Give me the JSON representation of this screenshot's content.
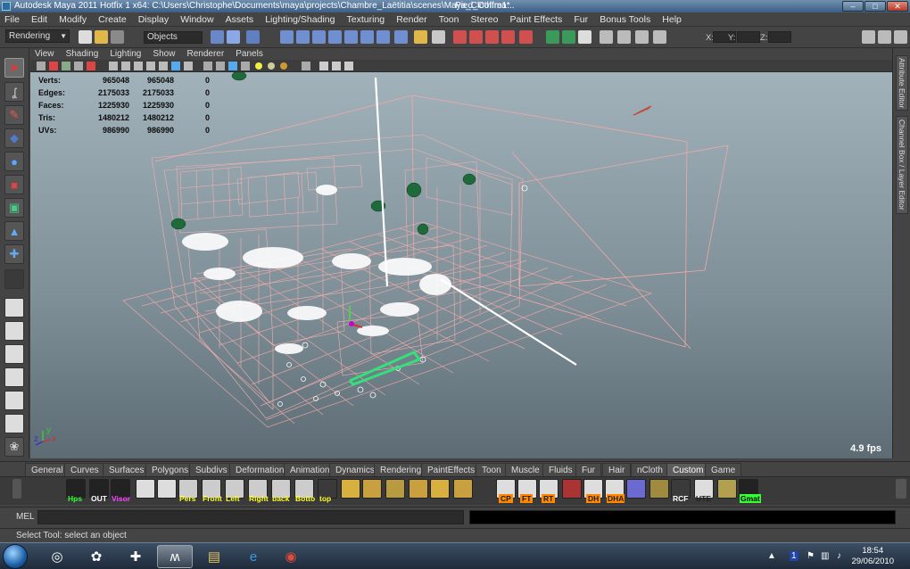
{
  "window": {
    "title": "Autodesk Maya 2011 Hotfix 1 x64: C:\\Users\\Christophe\\Documents\\maya\\projects\\Chambre_Laëtitia\\scenes\\Maya_Cloth.ma*",
    "second_title": "Pied_Coffre1...",
    "minimize": "–",
    "maximize": "□",
    "close": "✕"
  },
  "menubar": [
    "File",
    "Edit",
    "Modify",
    "Create",
    "Display",
    "Window",
    "Assets",
    "Lighting/Shading",
    "Texturing",
    "Render",
    "Toon",
    "Stereo",
    "Paint Effects",
    "Fur",
    "Bonus Tools",
    "Help"
  ],
  "statusline": {
    "mode": "Rendering",
    "selection_mask": "Objects",
    "x_label": "X:",
    "y_label": "Y:",
    "z_label": "Z:"
  },
  "viewport": {
    "menu": [
      "View",
      "Shading",
      "Lighting",
      "Show",
      "Renderer",
      "Panels"
    ],
    "hud": [
      {
        "label": "Verts:",
        "a": "965048",
        "b": "965048",
        "c": "0"
      },
      {
        "label": "Edges:",
        "a": "2175033",
        "b": "2175033",
        "c": "0"
      },
      {
        "label": "Faces:",
        "a": "1225930",
        "b": "1225930",
        "c": "0"
      },
      {
        "label": "Tris:",
        "a": "1480212",
        "b": "1480212",
        "c": "0"
      },
      {
        "label": "UVs:",
        "a": "986990",
        "b": "986990",
        "c": "0"
      }
    ],
    "fps": "4.9 fps",
    "axis_y": "y",
    "axis_z": "z",
    "axis_x": "x"
  },
  "sidebar": {
    "attribute_editor": "Attribute Editor",
    "channel_box": "Channel Box / Layer Editor"
  },
  "shelf": {
    "tabs": [
      "General",
      "Curves",
      "Surfaces",
      "Polygons",
      "Subdivs",
      "Deformation",
      "Animation",
      "Dynamics",
      "Rendering",
      "PaintEffects",
      "Toon",
      "Muscle",
      "Fluids",
      "Fur",
      "Hair",
      "nCloth",
      "Custom",
      "Game"
    ],
    "active_tab": "Custom",
    "buttons": [
      "Hps",
      "OUT",
      "Visor",
      "",
      "",
      "Pers",
      "Front",
      "Left",
      "Right",
      "back",
      "Botto",
      "top",
      "",
      "",
      "",
      "",
      "",
      "",
      "CP",
      "FT",
      "RT",
      "",
      "DH",
      "DHA",
      "",
      "",
      "RCF",
      "UTE",
      "",
      "Gmat"
    ]
  },
  "mel": {
    "label": "MEL"
  },
  "helpline": "Select Tool: select an object",
  "taskbar": {
    "time": "18:54",
    "date": "29/06/2010",
    "tray_badge": "1"
  },
  "colors": {
    "viewport_top": "#a1b2ba",
    "viewport_bottom": "#5d6c74",
    "wireframe": "#f2a8a8",
    "grid": "#f2a8a8",
    "selected_green": "#34e07a"
  }
}
